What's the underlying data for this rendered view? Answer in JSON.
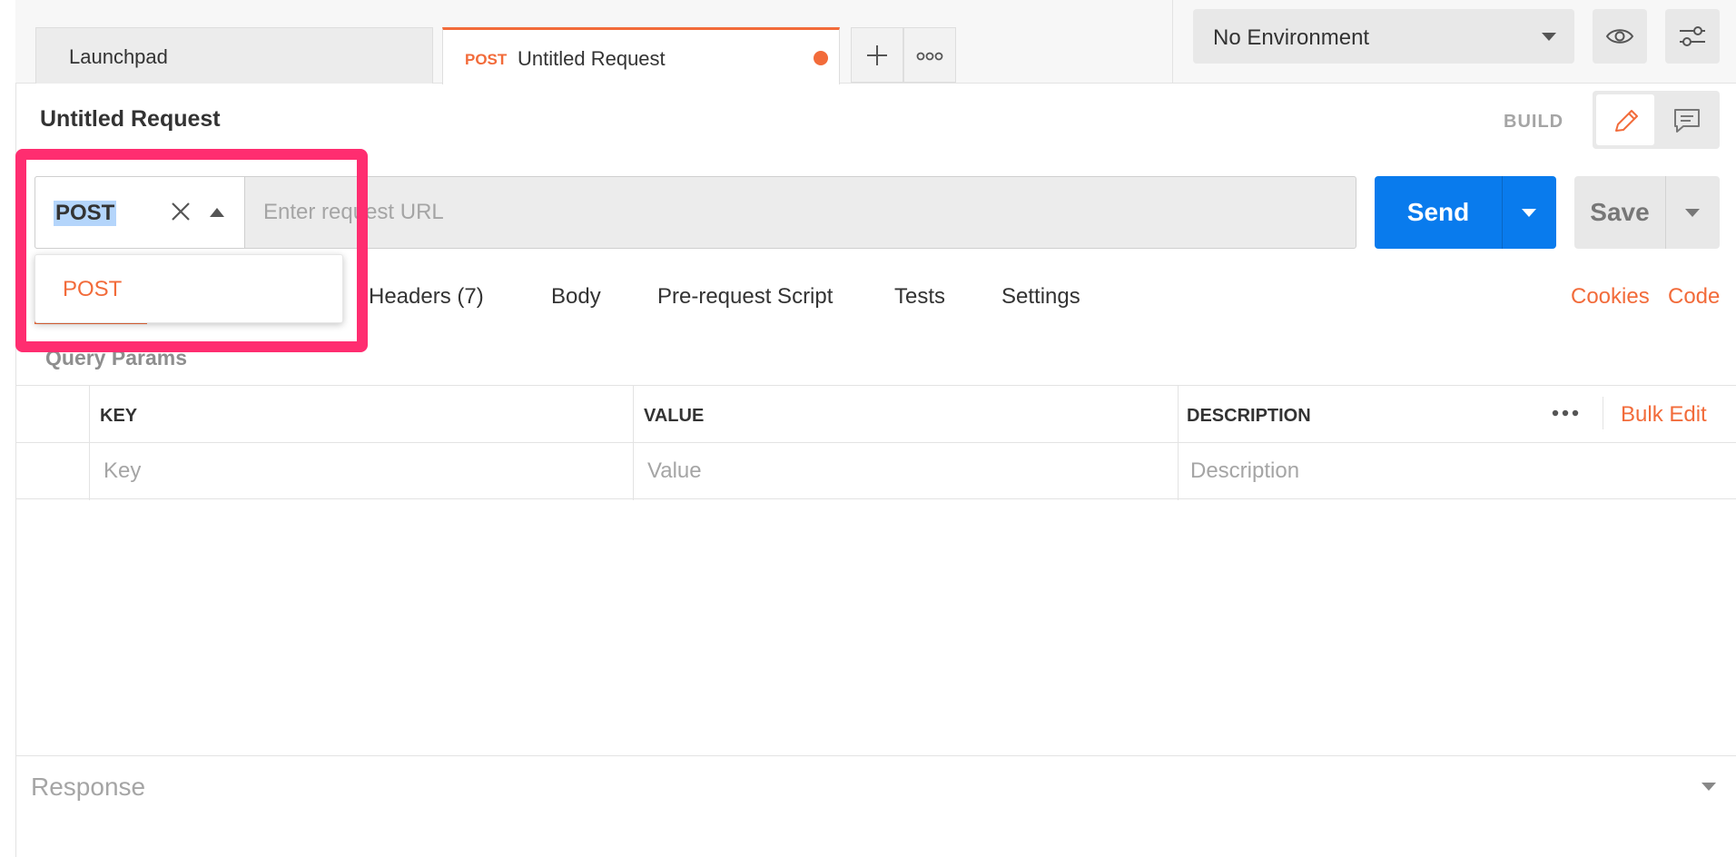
{
  "tabs": [
    {
      "label": "Launchpad"
    },
    {
      "method": "POST",
      "label": "Untitled Request",
      "unsaved": true
    }
  ],
  "tab_actions": {
    "add_icon": "plus-icon",
    "more_icon": "ellipsis-icon"
  },
  "environment": {
    "selected": "No Environment",
    "options": [
      "No Environment"
    ]
  },
  "request": {
    "title": "Untitled Request",
    "mode_label": "BUILD",
    "method": "POST",
    "method_options": [
      "POST"
    ],
    "url": "",
    "url_placeholder": "Enter request URL"
  },
  "actions": {
    "send": "Send",
    "save": "Save"
  },
  "subtabs": [
    {
      "label": "Headers",
      "count": "(7)"
    },
    {
      "label": "Body"
    },
    {
      "label": "Pre-request Script"
    },
    {
      "label": "Tests"
    },
    {
      "label": "Settings"
    }
  ],
  "links": {
    "cookies": "Cookies",
    "code": "Code"
  },
  "params": {
    "title": "Query Params",
    "columns": [
      "KEY",
      "VALUE",
      "DESCRIPTION"
    ],
    "bulk_edit": "Bulk Edit",
    "placeholders": [
      "Key",
      "Value",
      "Description"
    ]
  },
  "response": {
    "label": "Response"
  },
  "colors": {
    "accent": "#f26b3a",
    "send": "#097bed",
    "highlight": "#ff2d70",
    "selection": "#b4d5fb"
  }
}
